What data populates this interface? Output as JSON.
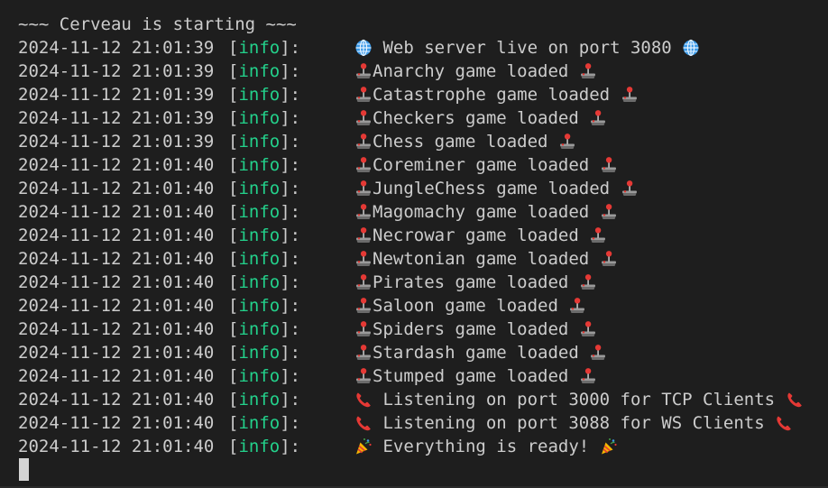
{
  "terminal": {
    "banner": "~~~ Cerveau is starting ~~~",
    "level_colors": {
      "info": "#23d18b"
    },
    "lines": [
      {
        "timestamp": "2024-11-12 21:01:39",
        "level": "info",
        "icon_before": "globe-icon",
        "message": " Web server live on port 3080 ",
        "icon_after": "globe-icon"
      },
      {
        "timestamp": "2024-11-12 21:01:39",
        "level": "info",
        "icon_before": "joystick-icon",
        "message": "Anarchy game loaded ",
        "icon_after": "joystick-icon"
      },
      {
        "timestamp": "2024-11-12 21:01:39",
        "level": "info",
        "icon_before": "joystick-icon",
        "message": "Catastrophe game loaded ",
        "icon_after": "joystick-icon"
      },
      {
        "timestamp": "2024-11-12 21:01:39",
        "level": "info",
        "icon_before": "joystick-icon",
        "message": "Checkers game loaded ",
        "icon_after": "joystick-icon"
      },
      {
        "timestamp": "2024-11-12 21:01:39",
        "level": "info",
        "icon_before": "joystick-icon",
        "message": "Chess game loaded ",
        "icon_after": "joystick-icon"
      },
      {
        "timestamp": "2024-11-12 21:01:40",
        "level": "info",
        "icon_before": "joystick-icon",
        "message": "Coreminer game loaded ",
        "icon_after": "joystick-icon"
      },
      {
        "timestamp": "2024-11-12 21:01:40",
        "level": "info",
        "icon_before": "joystick-icon",
        "message": "JungleChess game loaded ",
        "icon_after": "joystick-icon"
      },
      {
        "timestamp": "2024-11-12 21:01:40",
        "level": "info",
        "icon_before": "joystick-icon",
        "message": "Magomachy game loaded ",
        "icon_after": "joystick-icon"
      },
      {
        "timestamp": "2024-11-12 21:01:40",
        "level": "info",
        "icon_before": "joystick-icon",
        "message": "Necrowar game loaded ",
        "icon_after": "joystick-icon"
      },
      {
        "timestamp": "2024-11-12 21:01:40",
        "level": "info",
        "icon_before": "joystick-icon",
        "message": "Newtonian game loaded ",
        "icon_after": "joystick-icon"
      },
      {
        "timestamp": "2024-11-12 21:01:40",
        "level": "info",
        "icon_before": "joystick-icon",
        "message": "Pirates game loaded ",
        "icon_after": "joystick-icon"
      },
      {
        "timestamp": "2024-11-12 21:01:40",
        "level": "info",
        "icon_before": "joystick-icon",
        "message": "Saloon game loaded ",
        "icon_after": "joystick-icon"
      },
      {
        "timestamp": "2024-11-12 21:01:40",
        "level": "info",
        "icon_before": "joystick-icon",
        "message": "Spiders game loaded ",
        "icon_after": "joystick-icon"
      },
      {
        "timestamp": "2024-11-12 21:01:40",
        "level": "info",
        "icon_before": "joystick-icon",
        "message": "Stardash game loaded ",
        "icon_after": "joystick-icon"
      },
      {
        "timestamp": "2024-11-12 21:01:40",
        "level": "info",
        "icon_before": "joystick-icon",
        "message": "Stumped game loaded ",
        "icon_after": "joystick-icon"
      },
      {
        "timestamp": "2024-11-12 21:01:40",
        "level": "info",
        "icon_before": "telephone-icon",
        "message": " Listening on port 3000 for TCP Clients ",
        "icon_after": "telephone-icon"
      },
      {
        "timestamp": "2024-11-12 21:01:40",
        "level": "info",
        "icon_before": "telephone-icon",
        "message": " Listening on port 3088 for WS Clients ",
        "icon_after": "telephone-icon"
      },
      {
        "timestamp": "2024-11-12 21:01:40",
        "level": "info",
        "icon_before": "party-popper-icon",
        "message": " Everything is ready! ",
        "icon_after": "party-popper-icon"
      }
    ]
  }
}
